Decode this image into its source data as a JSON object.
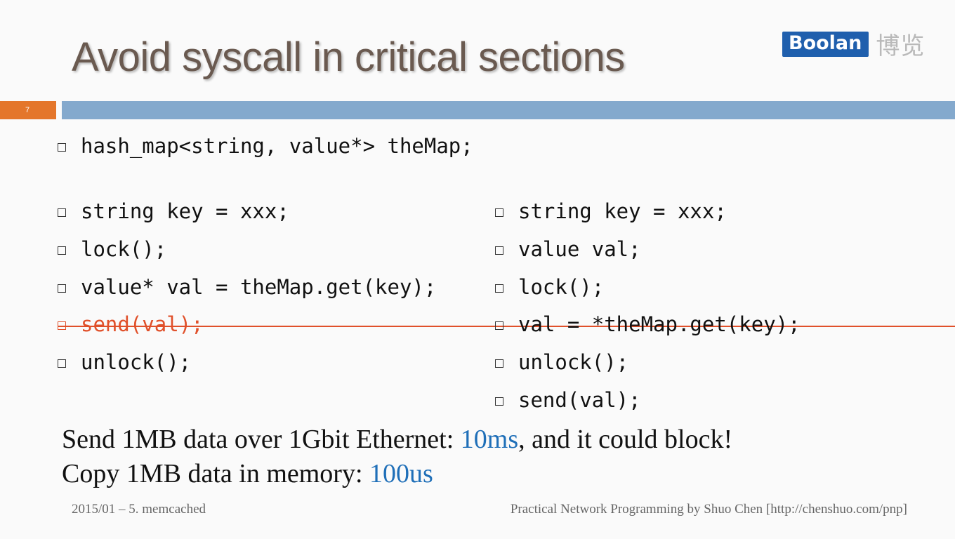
{
  "slide": {
    "title": "Avoid syscall in critical sections",
    "number": "7"
  },
  "logo": {
    "brand": "Boolan",
    "chinese": "博览"
  },
  "code": {
    "declaration": "hash_map<string, value*> theMap;",
    "left": [
      {
        "text": "string key = xxx;",
        "struck": false
      },
      {
        "text": "lock();",
        "struck": false
      },
      {
        "text": "value* val = theMap.get(key);",
        "struck": false
      },
      {
        "text": "send(val);",
        "struck": true
      },
      {
        "text": "unlock();",
        "struck": false
      }
    ],
    "right": [
      "string key = xxx;",
      "value val;",
      "lock();",
      "val = *theMap.get(key);",
      "unlock();",
      "send(val);"
    ]
  },
  "notes": {
    "line1_before": "Send 1MB data over 1Gbit Ethernet: ",
    "line1_highlight": "10ms",
    "line1_after": ", and it could block!",
    "line2_before": "Copy 1MB data in memory: ",
    "line2_highlight": "100us"
  },
  "footer": {
    "left": "2015/01 – 5. memcached",
    "right": "Practical Network Programming by Shuo Chen [http://chenshuo.com/pnp]"
  },
  "colors": {
    "accent_orange": "#e4762b",
    "accent_blue_bar": "#84a9cd",
    "highlight_blue": "#1f6fb8",
    "strike_red": "#e0502a",
    "logo_blue": "#1f5fad"
  }
}
